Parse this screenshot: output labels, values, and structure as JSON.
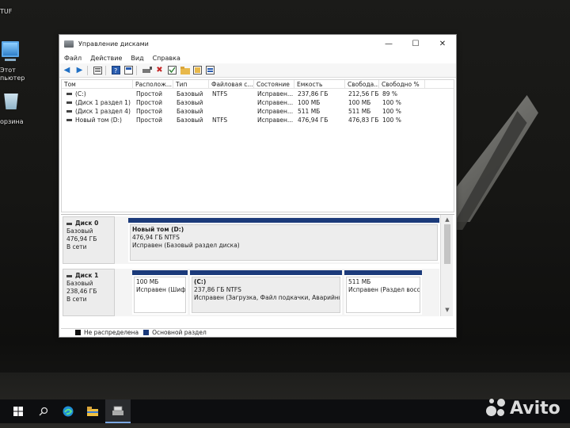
{
  "desktop": {
    "icons": [
      {
        "label": "TUF",
        "icon": "app-icon"
      },
      {
        "label": "Этот\nкомпьютер",
        "label_visible": "пьютер",
        "label_top": "Этот",
        "icon": "this-pc-icon"
      },
      {
        "label": "Корзина",
        "label_visible": "орзина",
        "icon": "recycle-bin-icon"
      }
    ]
  },
  "window": {
    "title": "Управление дисками",
    "controls": {
      "minimize": "—",
      "maximize": "☐",
      "close": "✕"
    }
  },
  "menu": [
    "Файл",
    "Действие",
    "Вид",
    "Справка"
  ],
  "toolbar": {
    "buttons": [
      "back-icon",
      "forward-icon",
      "list-view-icon",
      "properties-icon",
      "help-icon",
      "console-icon",
      "delete-icon",
      "checkmark-icon",
      "folder-icon",
      "new-volume-icon",
      "format-icon"
    ]
  },
  "volume_list": {
    "columns": [
      "Том",
      "Располож...",
      "Тип",
      "Файловая с...",
      "Состояние",
      "Емкость",
      "Свобода...",
      "Свободно %"
    ],
    "rows": [
      {
        "vol": "(C:)",
        "layout": "Простой",
        "type": "Базовый",
        "fs": "NTFS",
        "status": "Исправен...",
        "capacity": "237,86 ГБ",
        "free": "212,56 ГБ",
        "free_pct": "89 %"
      },
      {
        "vol": "(Диск 1 раздел 1)",
        "layout": "Простой",
        "type": "Базовый",
        "fs": "",
        "status": "Исправен...",
        "capacity": "100 МБ",
        "free": "100 МБ",
        "free_pct": "100 %"
      },
      {
        "vol": "(Диск 1 раздел 4)",
        "layout": "Простой",
        "type": "Базовый",
        "fs": "",
        "status": "Исправен...",
        "capacity": "511 МБ",
        "free": "511 МБ",
        "free_pct": "100 %"
      },
      {
        "vol": "Новый том (D:)",
        "layout": "Простой",
        "type": "Базовый",
        "fs": "NTFS",
        "status": "Исправен...",
        "capacity": "476,94 ГБ",
        "free": "476,83 ГБ",
        "free_pct": "100 %"
      }
    ]
  },
  "disks": [
    {
      "name": "Диск 0",
      "type": "Базовый",
      "size": "476,94 ГБ",
      "state": "В сети",
      "partitions": [
        {
          "title": "Новый том  (D:)",
          "size": "476,94 ГБ NTFS",
          "status": "Исправен (Базовый раздел диска)"
        }
      ]
    },
    {
      "name": "Диск 1",
      "type": "Базовый",
      "size": "238,46 ГБ",
      "state": "В сети",
      "partitions": [
        {
          "title": "",
          "size": "100 МБ",
          "status": "Исправен (Шифрс"
        },
        {
          "title": "(C:)",
          "size": "237,86 ГБ NTFS",
          "status": "Исправен (Загрузка, Файл подкачки, Аварийный дамп"
        },
        {
          "title": "",
          "size": "511 МБ",
          "status": "Исправен (Раздел восстан"
        }
      ]
    }
  ],
  "legend": [
    {
      "label": "Не распределена",
      "color": "#111111"
    },
    {
      "label": "Основной раздел",
      "color": "#1b3a7a"
    }
  ],
  "colors": {
    "partition_bar": "#1b3a7a",
    "unallocated": "#111111"
  },
  "taskbar": {
    "buttons": [
      "start-icon",
      "search-icon",
      "edge-icon",
      "explorer-icon",
      "disk-management-icon"
    ]
  },
  "watermark": "Avito"
}
